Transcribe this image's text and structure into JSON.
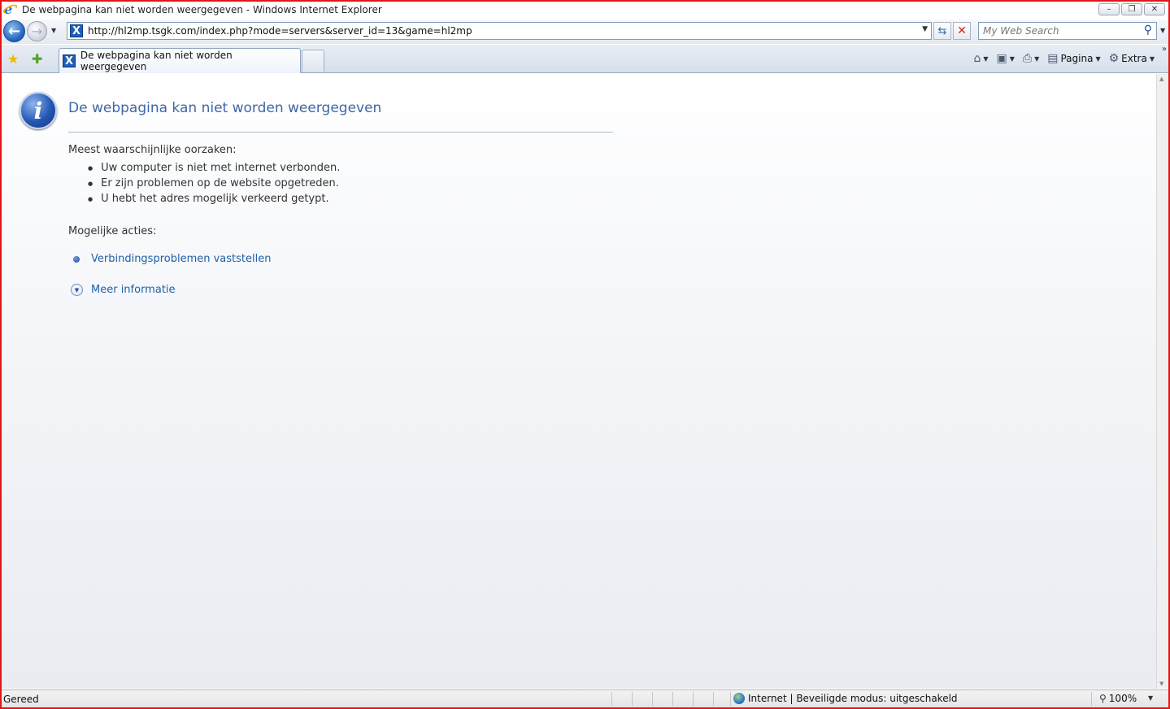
{
  "window": {
    "title": "De webpagina kan niet worden weergegeven - Windows Internet Explorer",
    "min_glyph": "–",
    "max_glyph": "❐",
    "close_glyph": "✕"
  },
  "address": {
    "url": "http://hl2mp.tsgk.com/index.php?mode=servers&server_id=13&game=hl2mp"
  },
  "search": {
    "placeholder": "My Web Search"
  },
  "tab": {
    "title": "De webpagina kan niet worden weergegeven"
  },
  "commandbar": {
    "page_label": "Pagina",
    "tools_label": "Extra"
  },
  "content": {
    "title": "De webpagina kan niet worden weergegeven",
    "causes_label": "Meest waarschijnlijke oorzaken:",
    "causes": [
      "Uw computer is niet met internet verbonden.",
      "Er zijn problemen op de website opgetreden.",
      "U hebt het adres mogelijk verkeerd getypt."
    ],
    "actions_label": "Mogelijke acties:",
    "actions": [
      "Verbindingsproblemen vaststellen",
      "Meer informatie"
    ]
  },
  "statusbar": {
    "status": "Gereed",
    "zone": "Internet | Beveiligde modus: uitgeschakeld",
    "zoom": "100%"
  },
  "icons": {
    "back": "back-arrow-icon",
    "forward": "forward-arrow-icon",
    "refresh": "refresh-icon",
    "stop": "stop-icon",
    "search": "search-icon",
    "favorites": "favorites-star-icon",
    "add_favorites": "add-favorites-icon",
    "home": "home-icon",
    "feeds": "feeds-icon",
    "print": "print-icon",
    "page": "page-icon",
    "tools": "gear-icon",
    "info": "info-icon",
    "globe": "globe-icon",
    "zoom": "zoom-icon"
  },
  "colors": {
    "frame": "#e0161a",
    "title_blue": "#3f67a5",
    "link_blue": "#1f5fa8"
  }
}
